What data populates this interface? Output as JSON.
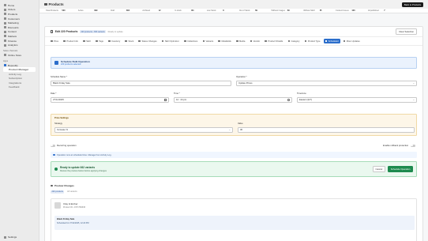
{
  "sidebar": {
    "items": [
      {
        "label": "Home",
        "icon": "home-icon"
      },
      {
        "label": "Orders",
        "icon": "orders-icon"
      },
      {
        "label": "Products",
        "icon": "tag-icon"
      },
      {
        "label": "Customers",
        "icon": "person-icon"
      },
      {
        "label": "Marketing",
        "icon": "target-icon"
      },
      {
        "label": "Discounts",
        "icon": "discount-icon"
      },
      {
        "label": "Content",
        "icon": "content-icon"
      },
      {
        "label": "Markets",
        "icon": "globe-icon"
      },
      {
        "label": "Finance",
        "icon": "finance-icon"
      },
      {
        "label": "Analytics",
        "icon": "chart-icon"
      }
    ],
    "section_sales": "Sales channels",
    "channel": "Online Store",
    "section_apps": "Apps",
    "app": "Bopoolify",
    "app_sub": [
      "Product Manager",
      "Activity Log",
      "Subscription",
      "Integrations",
      "Feedback"
    ],
    "settings": "Settings"
  },
  "topbar": {
    "title": "Products",
    "back_button": "Back to Products"
  },
  "stats": [
    "Total Products",
    "530",
    "Active",
    "499",
    "Draft",
    "804",
    "Archived",
    "12",
    "In stock",
    "531",
    "Low Stock",
    "8",
    "Out of Stock",
    "69",
    "Without Images",
    "69",
    "Without SEO",
    "85",
    "Content Issues",
    "106",
    "Unpublished",
    "7"
  ],
  "panel": {
    "title": "Edit 220 Products",
    "badge": "220 products • 393 variants",
    "status": "Ready to update",
    "clear_button": "Clear Selection"
  },
  "tabs": [
    {
      "label": "Price",
      "active": false
    },
    {
      "label": "Product Info",
      "active": false
    },
    {
      "label": "SEO",
      "active": false
    },
    {
      "label": "Tags",
      "active": false
    },
    {
      "label": "Inventory",
      "active": false
    },
    {
      "label": "Stock",
      "active": false
    },
    {
      "label": "Status Changes",
      "active": false
    },
    {
      "label": "SEO Optimizer",
      "active": false
    },
    {
      "label": "Collections",
      "active": false
    },
    {
      "label": "Variants",
      "active": false
    },
    {
      "label": "Metafields",
      "active": false
    },
    {
      "label": "Media",
      "active": false
    },
    {
      "label": "Vendor",
      "active": false
    },
    {
      "label": "Product Shields",
      "active": false
    },
    {
      "label": "Category",
      "active": false
    },
    {
      "label": "Product Type",
      "active": false
    },
    {
      "label": "Scheduled",
      "active": true
    },
    {
      "label": "More Updates",
      "active": false
    }
  ],
  "info": {
    "title": "Schedule Bulk Operation",
    "subtitle": "220 products selected"
  },
  "form": {
    "name_label": "Schedule Name *",
    "name_value": "Black Friday Sale",
    "operation_label": "Operation *",
    "operation_value": "Update Prices",
    "date_label": "Date *",
    "date_value": "27/11/2025",
    "time_label": "Time *",
    "time_value": "12 : 24 pm",
    "timezone_label": "Timezone",
    "timezone_value": "Eastern (ET)"
  },
  "dst": {
    "title": "Price Settings",
    "strategy_label": "Strategy",
    "strategy_value": "Increase %",
    "value_label": "Value",
    "value_value": "30"
  },
  "toggles": {
    "recurring": "Recurring operation",
    "rollback": "Enable rollback protection"
  },
  "note": "Operation runs at scheduled time. Manage from Activity Log.",
  "ready": {
    "title": "Ready to update 662 variants",
    "subtitle": "Review the preview below before applying changes",
    "cancel": "Cancel",
    "schedule": "Schedule Operation"
  },
  "preview": {
    "title": "Preview Changes",
    "tabs": [
      "220 products",
      "All variants"
    ],
    "item_name": "Clay & Ember",
    "item_meta": "Product ID  •  1571760636",
    "item_schedule_name": "Black Friday Sale",
    "item_schedule_time": "Scheduled for 27/11/2025, 12:24 PM"
  },
  "colors": {
    "accent": "#2c6ecb",
    "success": "#1d8a4e",
    "warning_bg": "#fdf6e8"
  }
}
